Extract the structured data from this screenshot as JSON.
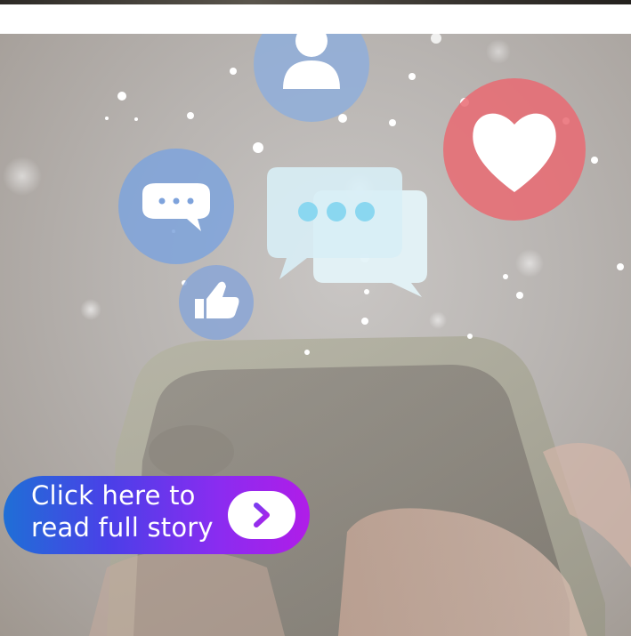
{
  "cta": {
    "line1": "Click here to",
    "line2": "read full story",
    "arrow_icon": "chevron-right-icon"
  },
  "colors": {
    "cta_gradient_start": "#1f6fd6",
    "cta_gradient_end": "#b01de8",
    "heart_bubble": "#e96a72",
    "avatar_bubble": "#8faedb",
    "chat_bubble": "#7ea3dc",
    "like_bubble": "#8aa6d6"
  },
  "icons": [
    "user-icon",
    "heart-icon",
    "chat-bubble-icon",
    "message-icon",
    "thumbs-up-icon"
  ]
}
